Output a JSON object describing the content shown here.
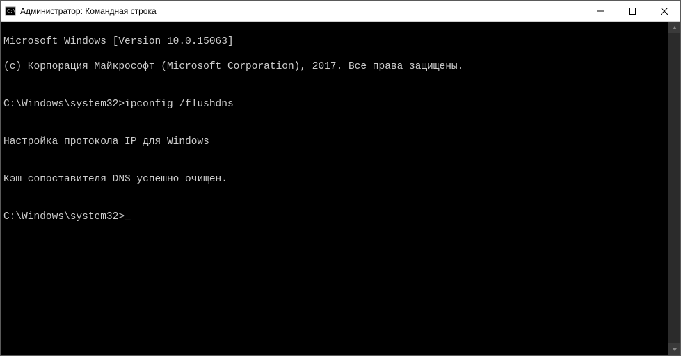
{
  "window": {
    "title": "Администратор: Командная строка"
  },
  "terminal": {
    "lines": {
      "l0": "Microsoft Windows [Version 10.0.15063]",
      "l1": "(c) Корпорация Майкрософт (Microsoft Corporation), 2017. Все права защищены.",
      "l2": "",
      "l3": "C:\\Windows\\system32>ipconfig /flushdns",
      "l4": "",
      "l5": "Настройка протокола IP для Windows",
      "l6": "",
      "l7": "Кэш сопоставителя DNS успешно очищен.",
      "l8": "",
      "l9": "C:\\Windows\\system32>_"
    }
  }
}
